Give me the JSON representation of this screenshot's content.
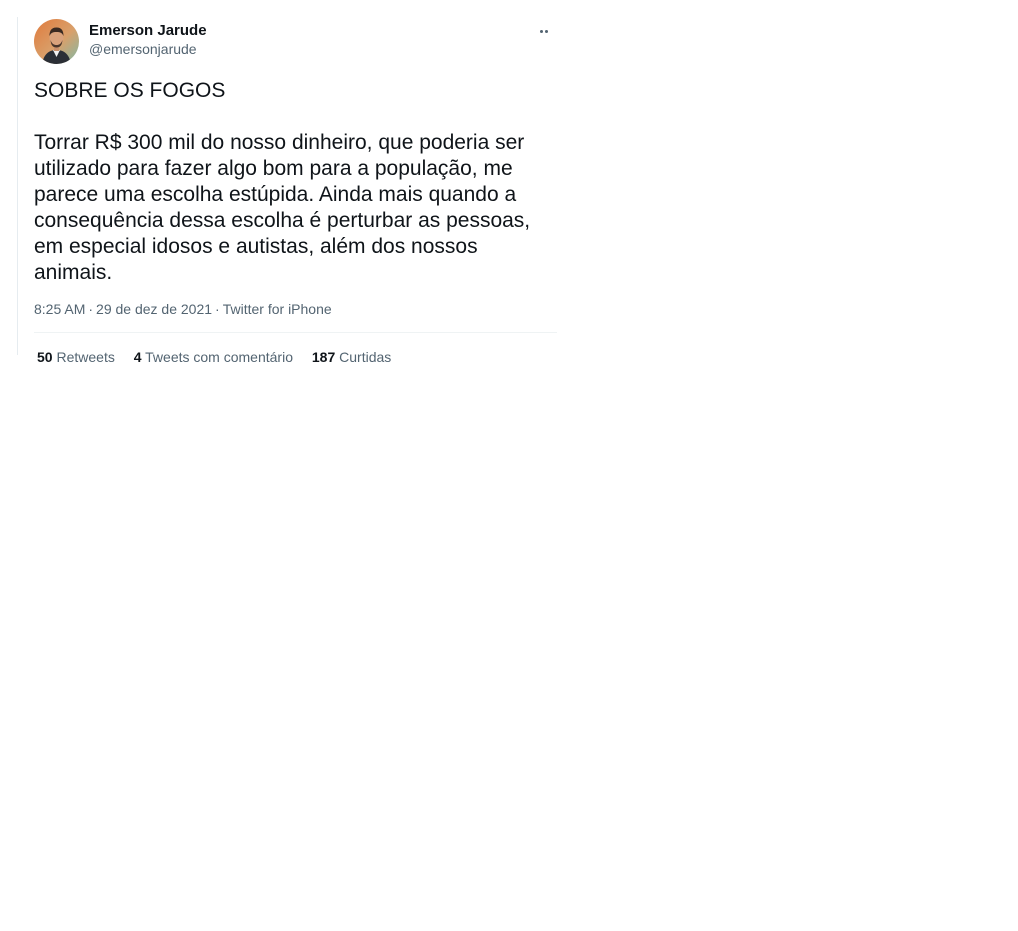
{
  "tweet": {
    "author": {
      "display_name": "Emerson Jarude",
      "handle": "@emersonjarude",
      "avatar_icon": "user-avatar-photo"
    },
    "more_icon": "more-options-icon",
    "title_line": "SOBRE OS FOGOS",
    "body": "Torrar R$ 300 mil do nosso dinheiro, que poderia ser utilizado para fazer algo bom para a população, me parece uma escolha estúpida. Ainda mais quando a consequência dessa escolha é perturbar as pessoas, em especial idosos e autistas, além dos nossos animais.",
    "time": "8:25 AM",
    "date": "29 de dez de 2021",
    "source": "Twitter for iPhone",
    "separator": "·",
    "stats": {
      "retweets_count": "50",
      "retweets_label": "Retweets",
      "quotes_count": "4",
      "quotes_label": "Tweets com comentário",
      "likes_count": "187",
      "likes_label": "Curtidas"
    }
  },
  "colors": {
    "text_primary": "#0f1419",
    "text_secondary": "#536471",
    "divider": "#eff3f4"
  }
}
